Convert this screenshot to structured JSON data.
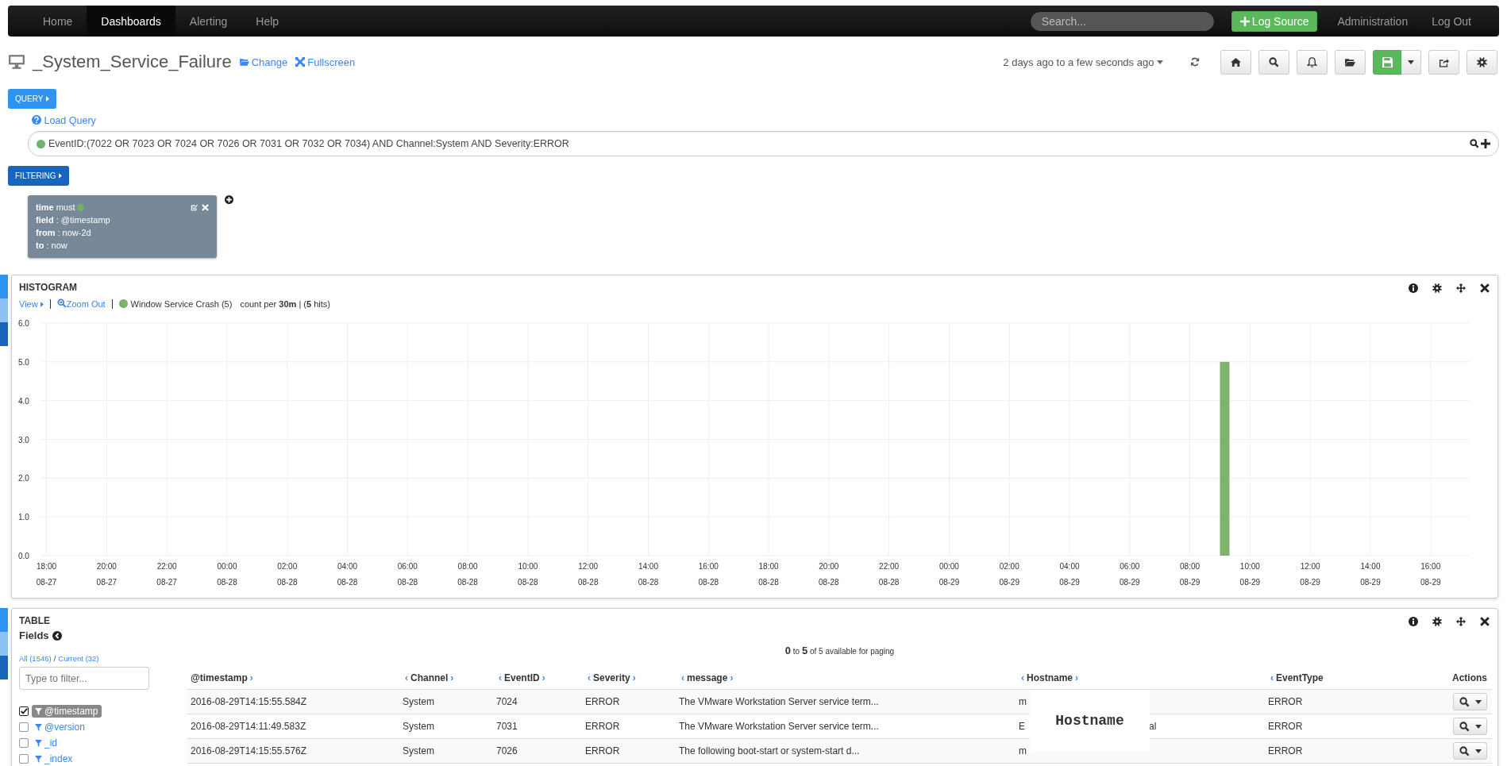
{
  "navbar": {
    "items": [
      {
        "label": "Home",
        "selected": false
      },
      {
        "label": "Dashboards",
        "selected": true
      },
      {
        "label": "Alerting",
        "selected": false
      },
      {
        "label": "Help",
        "selected": false
      }
    ],
    "search": {
      "placeholder": "Search..."
    },
    "log_source_button": "Log Source",
    "links": [
      "Administration",
      "Log Out"
    ]
  },
  "dashboard": {
    "title": "_System_Service_Failure",
    "links": [
      {
        "kind": "change",
        "label": "Change"
      },
      {
        "kind": "fullscreen",
        "label": "Fullscreen"
      }
    ],
    "time_range": "2 days ago to a few seconds ago"
  },
  "query": {
    "button": "QUERY",
    "load_query": "Load Query",
    "color": "#6db36d",
    "text": "EventID:(7022 OR 7023 OR 7024 OR 7026 OR 7031 OR 7032 OR 7034) AND Channel:System AND Severity:ERROR"
  },
  "filtering": {
    "button": "FILTERING",
    "filters": [
      {
        "type": "time",
        "mode": "must",
        "color": "#6db36d",
        "rows": [
          {
            "key": "field",
            "separator": ":",
            "value": "@timestamp"
          },
          {
            "key": "from",
            "separator": ":",
            "value": "now-2d"
          },
          {
            "key": "to",
            "separator": ":",
            "value": "now"
          }
        ]
      }
    ]
  },
  "histogram": {
    "title": "HISTOGRAM",
    "view": "View",
    "zoom_out": "Zoom Out",
    "legend_count": "(5)",
    "interval": "count per **30m** | (**5** hits)",
    "chart_data": {
      "type": "bar",
      "grid": true,
      "ylim": [
        0,
        6
      ],
      "categories": [
        "18:00 08-27",
        null,
        "20:00 08-27",
        null,
        "22:00 08-27",
        null,
        "00:00 08-28",
        null,
        "02:00 08-28",
        null,
        "04:00 08-28",
        null,
        "06:00 08-28",
        null,
        "08:00 08-28",
        null,
        "10:00 08-28",
        null,
        "12:00 08-28",
        null,
        "14:00 08-28",
        null,
        "16:00 08-28",
        null,
        "18:00 08-28",
        null,
        "20:00 08-28",
        null,
        "22:00 08-28",
        null,
        "00:00 08-29",
        null,
        "02:00 08-29",
        null,
        "04:00 08-29",
        null,
        "06:00 08-29",
        null,
        "08:00 08-29",
        null,
        "10:00 08-29",
        null,
        "12:00 08-29",
        null,
        "14:00 08-29",
        null,
        "16:00 08-29",
        null
      ],
      "series": [
        {
          "name": "Window Service Crash",
          "color": "#7eb26d",
          "values": [
            null,
            null,
            null,
            null,
            null,
            null,
            null,
            null,
            null,
            null,
            null,
            null,
            null,
            null,
            null,
            null,
            null,
            null,
            null,
            null,
            null,
            null,
            null,
            null,
            null,
            null,
            null,
            null,
            null,
            null,
            null,
            null,
            null,
            null,
            null,
            null,
            null,
            null,
            null,
            5,
            null,
            null,
            null,
            null,
            null,
            null,
            null,
            null
          ]
        }
      ],
      "yticks": [
        {
          "value": 0,
          "label": "0.0"
        },
        {
          "value": 1,
          "label": "1.0"
        },
        {
          "value": 2,
          "label": "2.0"
        },
        {
          "value": 3,
          "label": "3.0"
        },
        {
          "value": 4,
          "label": "4.0"
        },
        {
          "value": 5,
          "label": "5.0"
        },
        {
          "value": 6,
          "label": "6.0"
        }
      ]
    }
  },
  "table": {
    "title": "TABLE",
    "fields_title": "Fields",
    "all": "All (1546)",
    "separator": "/",
    "current": "Current (32)",
    "filter": {
      "placeholder": "Type to filter..."
    },
    "fields": [
      {
        "name": "@timestamp",
        "checked": true,
        "selected": true
      },
      {
        "name": "@version",
        "checked": false,
        "selected": false
      },
      {
        "name": "_id",
        "checked": false,
        "selected": false
      },
      {
        "name": "_index",
        "checked": false,
        "selected": false
      }
    ],
    "paging": "**0** to **5** of 5 available for paging",
    "columns": [
      {
        "label": "@timestamp",
        "next": "›"
      },
      {
        "label": "Channel",
        "prev": "‹",
        "next": "›"
      },
      {
        "label": "EventID",
        "prev": "‹",
        "next": "›"
      },
      {
        "label": "Severity",
        "prev": "‹",
        "next": "›"
      },
      {
        "label": "message",
        "prev": "‹",
        "next": "›"
      },
      {
        "label": "Hostname",
        "prev": "‹",
        "next": "›"
      },
      {
        "label": "EventType",
        "prev": "‹"
      },
      {
        "label": "Actions"
      }
    ],
    "rows": [
      {
        "timestamp": "2016-08-29T14:15:55.584Z",
        "channel": "System",
        "event_id": "7024",
        "severity": "ERROR",
        "message": "The VMware Workstation Server service term...",
        "hostname_start": "m",
        "event_type": "ERROR"
      },
      {
        "timestamp": "2016-08-29T14:11:49.583Z",
        "channel": "System",
        "event_id": "7031",
        "severity": "ERROR",
        "message": "The VMware Workstation Server service term...",
        "hostname_start": "E",
        "hostname_end": "al",
        "event_type": "ERROR"
      },
      {
        "timestamp": "2016-08-29T14:15:55.576Z",
        "channel": "System",
        "event_id": "7026",
        "severity": "ERROR",
        "message": "The following boot-start or system-start d...",
        "hostname_start": "m",
        "event_type": "ERROR"
      }
    ],
    "hostname_overlay": "Hostname"
  }
}
